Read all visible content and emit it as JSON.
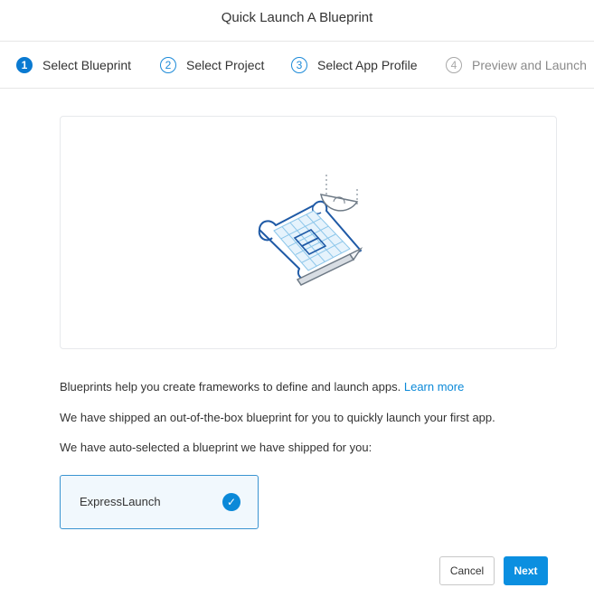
{
  "dialog": {
    "title": "Quick Launch A Blueprint"
  },
  "steps": [
    {
      "number": "1",
      "label": "Select Blueprint",
      "state": "active"
    },
    {
      "number": "2",
      "label": "Select Project",
      "state": "upcoming"
    },
    {
      "number": "3",
      "label": "Select App Profile",
      "state": "upcoming"
    },
    {
      "number": "4",
      "label": "Preview and Launch",
      "state": "disabled"
    }
  ],
  "illustration": {
    "icon": "blueprint-drafting-icon"
  },
  "description": {
    "line1": "Blueprints help you create frameworks to define and launch apps.",
    "learn_more": "Learn more",
    "line2": "We have shipped an out-of-the-box blueprint for you to quickly launch your first app.",
    "line3": "We have auto-selected a blueprint we have shipped for you:"
  },
  "selected_blueprint": {
    "name": "ExpressLaunch",
    "selected": true,
    "check_icon": "checkmark-icon"
  },
  "buttons": {
    "cancel": "Cancel",
    "next": "Next"
  },
  "colors": {
    "accent": "#0b89d8",
    "selected_bg": "#f1f8fd",
    "selected_border": "#3a94d1"
  }
}
